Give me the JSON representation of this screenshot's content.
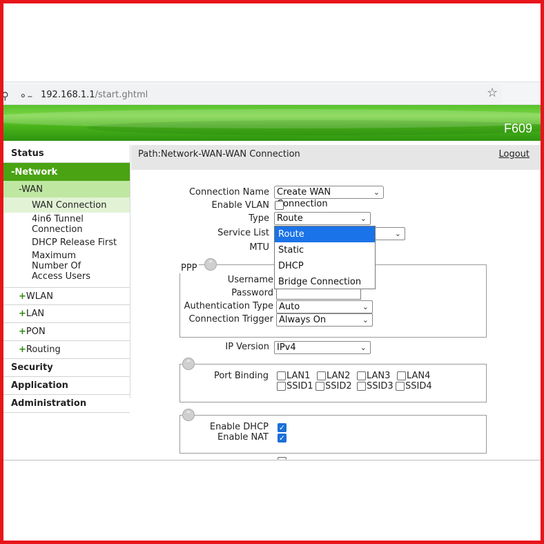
{
  "browser": {
    "url_host": "192.168.1.1",
    "url_path": "/start.ghtml",
    "icons": [
      "site-permissions-icon",
      "key-icon",
      "bookmark-star-icon"
    ]
  },
  "banner": {
    "model": "F609"
  },
  "colors": {
    "accent": "#4aa312",
    "wan_bg": "#bfe7a1",
    "active_bg": "#e2f3d5",
    "dropdown_selected": "#1a73e8",
    "frame": "#e8141a"
  },
  "sidebar": {
    "status": "Status",
    "network": "-Network",
    "wan": "-WAN",
    "wan_items": [
      "WAN Connection",
      "4in6 Tunnel Connection",
      "DHCP Release First",
      "Maximum Number Of Access Users"
    ],
    "wlan": "WLAN",
    "lan": "LAN",
    "pon": "PON",
    "routing": "Routing",
    "plus": "+",
    "security": "Security",
    "application": "Application",
    "administration": "Administration"
  },
  "pathbar": {
    "path": "Path:Network-WAN-WAN Connection",
    "logout": "Logout"
  },
  "form": {
    "connection_name_label": "Connection Name",
    "connection_name_value": "Create WAN Connection",
    "enable_vlan_label": "Enable VLAN",
    "enable_vlan_checked": false,
    "type_label": "Type",
    "type_value": "Route",
    "service_list_label": "Service List",
    "mtu_label": "MTU",
    "type_options": [
      "Route",
      "Static",
      "DHCP",
      "Bridge Connection"
    ],
    "ppp": {
      "legend": "PPP",
      "username_label": "Username",
      "password_label": "Password",
      "auth_type_label": "Authentication Type",
      "auth_type_value": "Auto",
      "trigger_label": "Connection Trigger",
      "trigger_value": "Always On"
    },
    "ip_version_label": "IP Version",
    "ip_version_value": "IPv4",
    "port_binding_label": "Port Binding",
    "ports_row1": [
      "LAN1",
      "LAN2",
      "LAN3",
      "LAN4"
    ],
    "ports_row2": [
      "SSID1",
      "SSID2",
      "SSID3",
      "SSID4"
    ],
    "enable_dhcp_label": "Enable DHCP",
    "enable_dhcp_checked": true,
    "enable_nat_label": "Enable NAT",
    "enable_nat_checked": true
  }
}
